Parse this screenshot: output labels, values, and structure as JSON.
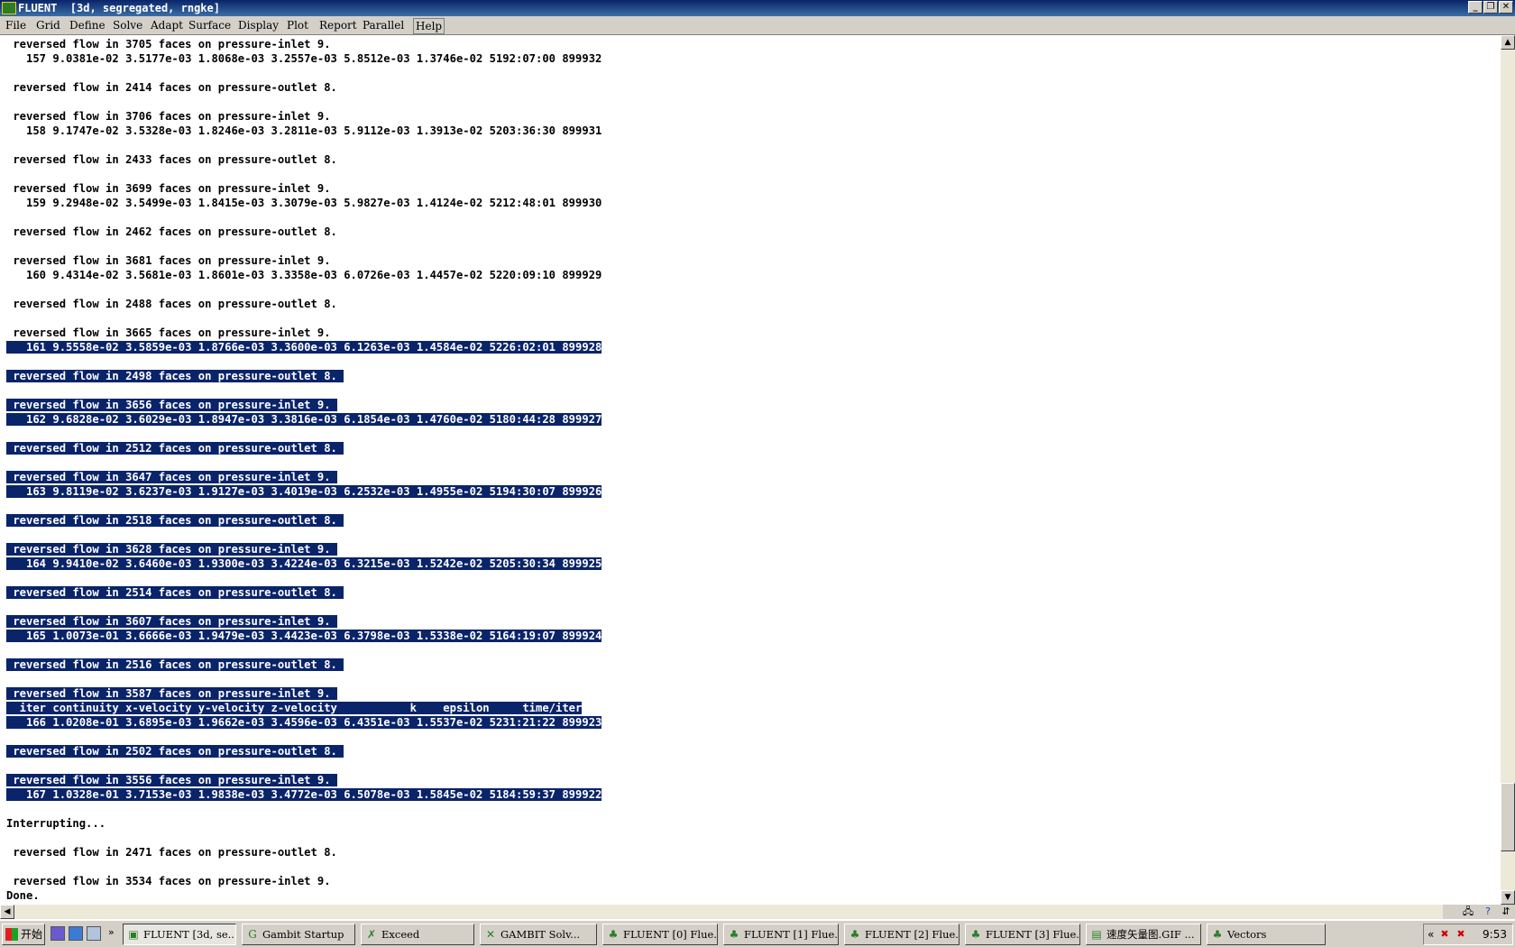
{
  "window": {
    "title": "FLUENT  [3d, segregated, rngke]",
    "controls": {
      "minimize": "_",
      "restore": "❐",
      "close": "✕"
    }
  },
  "menu": [
    "File",
    "Grid",
    "Define",
    "Solve",
    "Adapt",
    "Surface",
    "Display",
    "Plot",
    "Report",
    "Parallel",
    "Help"
  ],
  "console": {
    "lines": [
      {
        "text": " reversed flow in 3705 faces on pressure-inlet 9.",
        "sel": false
      },
      {
        "text": "   157 9.0381e-02 3.5177e-03 1.8068e-03 3.2557e-03 5.8512e-03 1.3746e-02 5192:07:00 899932",
        "sel": false
      },
      {
        "text": "",
        "sel": false
      },
      {
        "text": " reversed flow in 2414 faces on pressure-outlet 8.",
        "sel": false
      },
      {
        "text": "",
        "sel": false
      },
      {
        "text": " reversed flow in 3706 faces on pressure-inlet 9.",
        "sel": false
      },
      {
        "text": "   158 9.1747e-02 3.5328e-03 1.8246e-03 3.2811e-03 5.9112e-03 1.3913e-02 5203:36:30 899931",
        "sel": false
      },
      {
        "text": "",
        "sel": false
      },
      {
        "text": " reversed flow in 2433 faces on pressure-outlet 8.",
        "sel": false
      },
      {
        "text": "",
        "sel": false
      },
      {
        "text": " reversed flow in 3699 faces on pressure-inlet 9.",
        "sel": false
      },
      {
        "text": "   159 9.2948e-02 3.5499e-03 1.8415e-03 3.3079e-03 5.9827e-03 1.4124e-02 5212:48:01 899930",
        "sel": false
      },
      {
        "text": "",
        "sel": false
      },
      {
        "text": " reversed flow in 2462 faces on pressure-outlet 8.",
        "sel": false
      },
      {
        "text": "",
        "sel": false
      },
      {
        "text": " reversed flow in 3681 faces on pressure-inlet 9.",
        "sel": false
      },
      {
        "text": "   160 9.4314e-02 3.5681e-03 1.8601e-03 3.3358e-03 6.0726e-03 1.4457e-02 5220:09:10 899929",
        "sel": false
      },
      {
        "text": "",
        "sel": false
      },
      {
        "text": " reversed flow in 2488 faces on pressure-outlet 8.",
        "sel": false
      },
      {
        "text": "",
        "sel": false
      },
      {
        "text": " reversed flow in 3665 faces on pressure-inlet 9.",
        "sel": false
      },
      {
        "text": "   161 9.5558e-02 3.5859e-03 1.8766e-03 3.3600e-03 6.1263e-03 1.4584e-02 5226:02:01 899928",
        "sel": true
      },
      {
        "text": "",
        "sel": false
      },
      {
        "text": " reversed flow in 2498 faces on pressure-outlet 8. ",
        "sel": true
      },
      {
        "text": "",
        "sel": false
      },
      {
        "text": " reversed flow in 3656 faces on pressure-inlet 9. ",
        "sel": true
      },
      {
        "text": "   162 9.6828e-02 3.6029e-03 1.8947e-03 3.3816e-03 6.1854e-03 1.4760e-02 5180:44:28 899927",
        "sel": true
      },
      {
        "text": "",
        "sel": false
      },
      {
        "text": " reversed flow in 2512 faces on pressure-outlet 8. ",
        "sel": true
      },
      {
        "text": "",
        "sel": false
      },
      {
        "text": " reversed flow in 3647 faces on pressure-inlet 9. ",
        "sel": true
      },
      {
        "text": "   163 9.8119e-02 3.6237e-03 1.9127e-03 3.4019e-03 6.2532e-03 1.4955e-02 5194:30:07 899926",
        "sel": true
      },
      {
        "text": "",
        "sel": false
      },
      {
        "text": " reversed flow in 2518 faces on pressure-outlet 8. ",
        "sel": true
      },
      {
        "text": "",
        "sel": false
      },
      {
        "text": " reversed flow in 3628 faces on pressure-inlet 9. ",
        "sel": true
      },
      {
        "text": "   164 9.9410e-02 3.6460e-03 1.9300e-03 3.4224e-03 6.3215e-03 1.5242e-02 5205:30:34 899925",
        "sel": true
      },
      {
        "text": "",
        "sel": false
      },
      {
        "text": " reversed flow in 2514 faces on pressure-outlet 8. ",
        "sel": true
      },
      {
        "text": "",
        "sel": false
      },
      {
        "text": " reversed flow in 3607 faces on pressure-inlet 9. ",
        "sel": true
      },
      {
        "text": "   165 1.0073e-01 3.6666e-03 1.9479e-03 3.4423e-03 6.3798e-03 1.5338e-02 5164:19:07 899924",
        "sel": true
      },
      {
        "text": "",
        "sel": false
      },
      {
        "text": " reversed flow in 2516 faces on pressure-outlet 8. ",
        "sel": true
      },
      {
        "text": "",
        "sel": false
      },
      {
        "text": " reversed flow in 3587 faces on pressure-inlet 9. ",
        "sel": true
      },
      {
        "text": "  iter continuity x-velocity y-velocity z-velocity           k    epsilon     time/iter",
        "sel": true
      },
      {
        "text": "   166 1.0208e-01 3.6895e-03 1.9662e-03 3.4596e-03 6.4351e-03 1.5537e-02 5231:21:22 899923",
        "sel": true
      },
      {
        "text": "",
        "sel": false
      },
      {
        "text": " reversed flow in 2502 faces on pressure-outlet 8. ",
        "sel": true
      },
      {
        "text": "",
        "sel": false
      },
      {
        "text": " reversed flow in 3556 faces on pressure-inlet 9. ",
        "sel": true
      },
      {
        "text": "   167 1.0328e-01 3.7153e-03 1.9838e-03 3.4772e-03 6.5078e-03 1.5845e-02 5184:59:37 899922",
        "sel": true
      },
      {
        "text": "",
        "sel": false
      },
      {
        "text": "Interrupting...",
        "sel": false
      },
      {
        "text": "",
        "sel": false
      },
      {
        "text": " reversed flow in 2471 faces on pressure-outlet 8.",
        "sel": false
      },
      {
        "text": "",
        "sel": false
      },
      {
        "text": " reversed flow in 3534 faces on pressure-inlet 9.",
        "sel": false
      },
      {
        "text": "Done.",
        "sel": false
      }
    ]
  },
  "scroll": {
    "up": "▲",
    "down": "▼",
    "left": "◀",
    "position": 0.95
  },
  "taskbar": {
    "start_label": "开始",
    "tasks": [
      {
        "label": "FLUENT  [3d, se...",
        "icon": "fluent-icon",
        "glyph": "▣",
        "active": true
      },
      {
        "label": "Gambit Startup",
        "icon": "gambit-icon",
        "glyph": "G",
        "active": false
      },
      {
        "label": "Exceed",
        "icon": "exceed-icon",
        "glyph": "✗",
        "active": false
      },
      {
        "label": "GAMBIT     Solv...",
        "icon": "gambit-solver-icon",
        "glyph": "✕",
        "active": false
      },
      {
        "label": "FLUENT [0] Flue...",
        "icon": "fluent-node-icon",
        "glyph": "♣",
        "active": false
      },
      {
        "label": "FLUENT [1] Flue...",
        "icon": "fluent-node-icon",
        "glyph": "♣",
        "active": false
      },
      {
        "label": "FLUENT [2] Flue...",
        "icon": "fluent-node-icon",
        "glyph": "♣",
        "active": false
      },
      {
        "label": "FLUENT [3] Flue...",
        "icon": "fluent-node-icon",
        "glyph": "♣",
        "active": false
      },
      {
        "label": "速度矢量图.GIF ...",
        "icon": "image-viewer-icon",
        "glyph": "▤",
        "active": false
      },
      {
        "label": "Vectors",
        "icon": "vectors-icon",
        "glyph": "♣",
        "active": false
      }
    ],
    "tray_chevron": "«",
    "clock": "9:53"
  },
  "colors": {
    "selection": "#0a246a",
    "titlebar": "#0a246a",
    "chrome": "#d4d0c8"
  }
}
